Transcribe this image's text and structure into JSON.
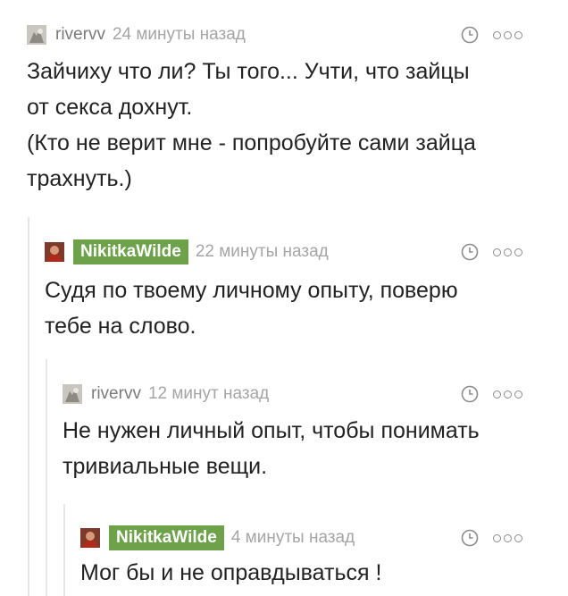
{
  "comments": [
    {
      "author": "rivervv",
      "time": "24 минуты назад",
      "lines": [
        "Зайчиху что ли? Ты того... Учти, что зайцы",
        "от секса дохнут.",
        "(Кто не верит мне - попробуйте сами зайца",
        "трахнуть.)"
      ],
      "is_op": false
    },
    {
      "author": "NikitkaWilde",
      "time": "22 минуты назад",
      "lines": [
        "Судя по твоему личному опыту, поверю",
        "тебе на слово."
      ],
      "is_op": true
    },
    {
      "author": "rivervv",
      "time": "12 минут назад",
      "lines": [
        "Не нужен личный опыт, чтобы понимать",
        "тривиальные вещи."
      ],
      "is_op": false
    },
    {
      "author": "NikitkaWilde",
      "time": "4 минуты назад",
      "lines": [
        "Мог бы и не оправдываться !"
      ],
      "is_op": true
    }
  ],
  "icons": {
    "time": "clock-icon",
    "menu": "more-options-icon"
  },
  "colors": {
    "op_badge": "#6ea24a",
    "muted_text": "#a5a5a5",
    "author_text": "#7a7a7a",
    "thread_line": "#e6e6e6"
  }
}
